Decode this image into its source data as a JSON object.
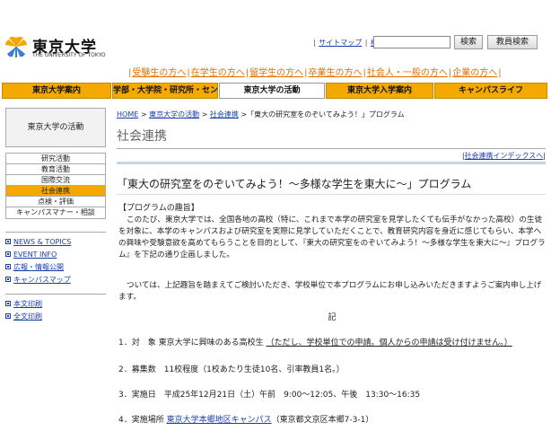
{
  "header": {
    "logo_ja": "東京大学",
    "logo_en": "THE UNIVERSITY OF TOKYO",
    "sitemap": "サイトマップ",
    "search_link": "検索",
    "search_value": "",
    "search_button": "検索",
    "staff_button": "教員検索"
  },
  "audience": [
    "受験生の方へ",
    "在学生の方へ",
    "留学生の方へ",
    "卒業生の方へ",
    "社会人・一般の方へ",
    "企業の方へ"
  ],
  "mainnav": [
    {
      "label": "東京大学案内"
    },
    {
      "label": "学部・大学院・研究所・センター"
    },
    {
      "label": "東京大学の活動"
    },
    {
      "label": "東京大学入学案内"
    },
    {
      "label": "キャンパスライフ"
    }
  ],
  "sidebar": {
    "title": "東京大学の活動",
    "menu": [
      "研究活動",
      "教育活動",
      "国際交流",
      "社会連携",
      "点検・評価",
      "キャンパスマナー・相談"
    ],
    "links": [
      "NEWS & TOPICS",
      "EVENT INFO",
      "広報・情報公開",
      "キャンパスマップ"
    ],
    "print": [
      "本文印刷",
      "全文印刷"
    ]
  },
  "breadcrumb": {
    "home": "HOME",
    "sep": ">",
    "crumb1": "東京大学の活動",
    "crumb2": "社会連携",
    "current": "「東大の研究室をのぞいてみよう！」プログラム"
  },
  "section_title": "社会連携",
  "index_link": "社会連携インデックスへ",
  "program_title": "「東大の研究室をのぞいてみよう！～多様な学生を東大に～」プログラム",
  "content": {
    "purpose_head": "【プログラムの趣旨】",
    "intro": "このたび、東京大学では、全国各地の高校（特に、これまで本学の研究室を見学したくても伝手がなかった高校）の生徒を対象に、本学のキャンパスおよび研究室を実際に見学していただくことで、教育研究内容を身近に感じてもらい、本学への興味や受験意欲を高めてもらうことを目的として、『東大の研究室をのぞいてみよう！～多様な学生を東大に～』プログラム』を下記の通り企画しました。",
    "second": "ついては、上記趣旨を踏まえてご検討いただき、学校単位で本プログラムにお申し込みいただきますようご案内申し上げます。",
    "ki": "記",
    "item1_label": "1．対　象",
    "item1_value": "東京大学に興味のある高校生",
    "item1_note": "（ただし、学校単位での申請。個人からの申請は受け付けません。）",
    "item2": "2．募集数　11校程度（1校あたり生徒10名、引率教員1名。）",
    "item3": "3．実施日　平成25年12月21日（土）午前　9:00～12:05、午後　13:30～16:35",
    "item4_label": "4．実施場所",
    "item4_link": "東京大学本郷地区キャンパス",
    "item4_addr": "（東京都文京区本郷7-3-1）"
  }
}
